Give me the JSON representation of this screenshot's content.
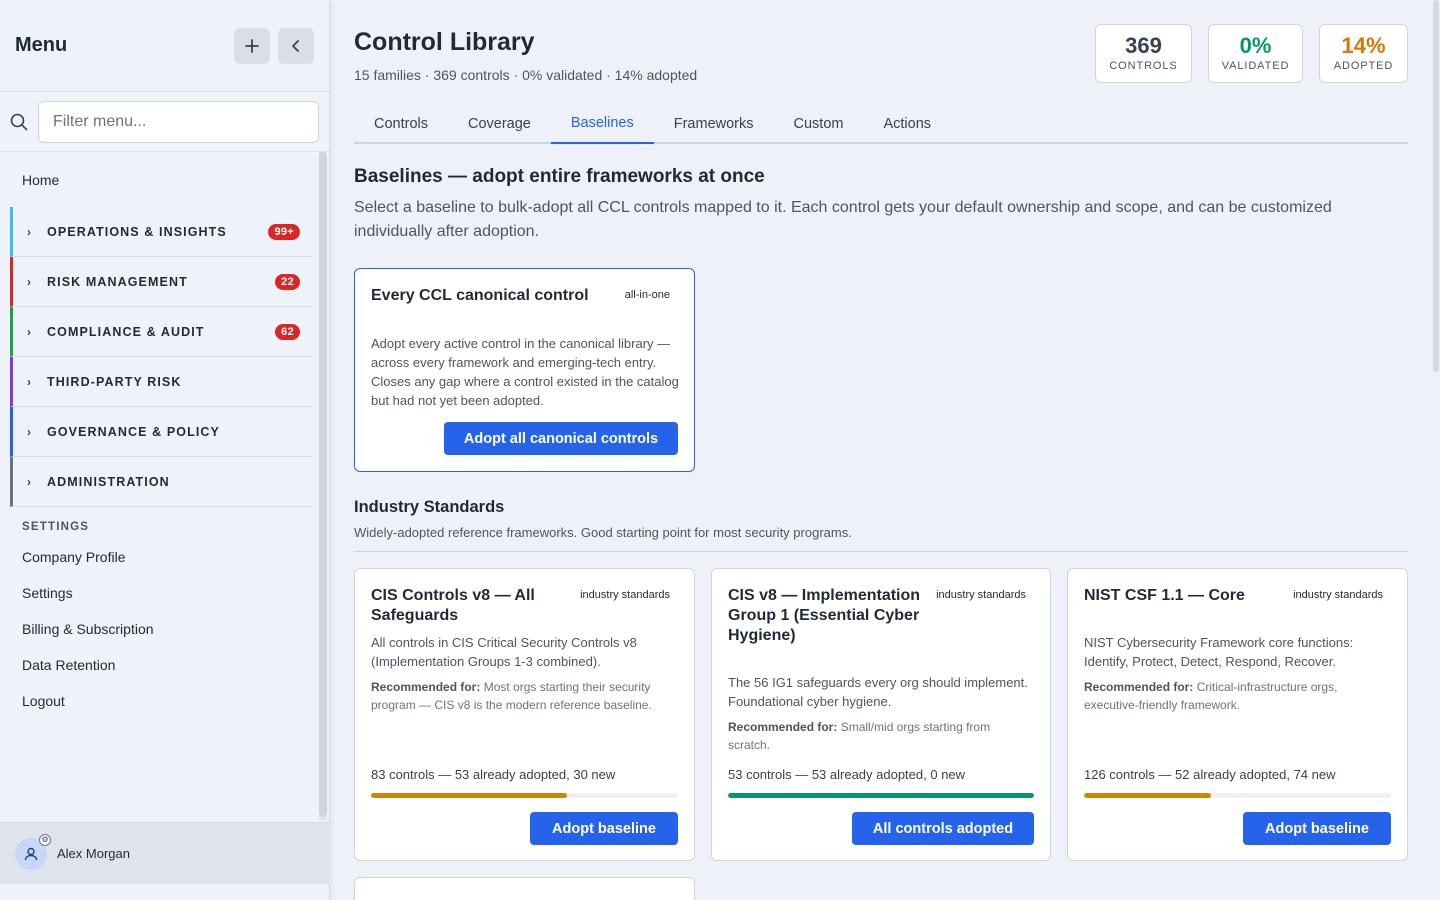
{
  "sidebar": {
    "title": "Menu",
    "search_placeholder": "Filter menu...",
    "home_label": "Home",
    "groups": [
      {
        "label": "OPERATIONS & INSIGHTS",
        "badge": "99+",
        "color": "#38bdf8"
      },
      {
        "label": "RISK MANAGEMENT",
        "badge": "22",
        "color": "#dc2626"
      },
      {
        "label": "COMPLIANCE & AUDIT",
        "badge": "62",
        "color": "#16a34a"
      },
      {
        "label": "THIRD-PARTY RISK",
        "badge": "",
        "color": "#7c3aed"
      },
      {
        "label": "GOVERNANCE & POLICY",
        "badge": "",
        "color": "#2563eb"
      },
      {
        "label": "ADMINISTRATION",
        "badge": "",
        "color": "#6b7280"
      }
    ],
    "settings_header": "SETTINGS",
    "settings_items": [
      "Company Profile",
      "Settings",
      "Billing & Subscription",
      "Data Retention",
      "Logout"
    ],
    "user_name": "Alex Morgan"
  },
  "header": {
    "title": "Control Library",
    "subtitle": "15 families · 369 controls · 0% validated · 14% adopted",
    "stats": [
      {
        "value": "369",
        "label": "CONTROLS",
        "color": "#374151"
      },
      {
        "value": "0%",
        "label": "VALIDATED",
        "color": "#059669"
      },
      {
        "value": "14%",
        "label": "ADOPTED",
        "color": "#d97706"
      }
    ]
  },
  "tabs": [
    "Controls",
    "Coverage",
    "Baselines",
    "Frameworks",
    "Custom",
    "Actions"
  ],
  "active_tab": "Baselines",
  "baselines": {
    "title": "Baselines — adopt entire frameworks at once",
    "description": "Select a baseline to bulk-adopt all CCL controls mapped to it. Each control gets your default ownership and scope, and can be customized individually after adoption.",
    "canonical": {
      "title": "Every CCL canonical control",
      "tag": "all-in-one",
      "description": "Adopt every active control in the canonical library — across every framework and emerging-tech entry. Closes any gap where a control existed in the catalog but had not yet been adopted.",
      "button": "Adopt all canonical controls"
    }
  },
  "industry": {
    "title": "Industry Standards",
    "description": "Widely-adopted reference frameworks. Good starting point for most security programs.",
    "cards": [
      {
        "title": "CIS Controls v8 — All Safeguards",
        "tag": "industry standards",
        "description": "All controls in CIS Critical Security Controls v8 (Implementation Groups 1-3 combined).",
        "rec_label": "Recommended for:",
        "rec_text": "Most orgs starting their security program — CIS v8 is the modern reference baseline.",
        "count_text": "83 controls — 53 already adopted, 30 new",
        "progress": 0.639,
        "bar_color": "#ca8a04",
        "button": "Adopt baseline"
      },
      {
        "title": "CIS v8 — Implementation Group 1 (Essential Cyber Hygiene)",
        "tag": "industry standards",
        "description": "The 56 IG1 safeguards every org should implement. Foundational cyber hygiene.",
        "rec_label": "Recommended for:",
        "rec_text": "Small/mid orgs starting from scratch.",
        "count_text": "53 controls — 53 already adopted, 0 new",
        "progress": 1.0,
        "bar_color": "#059669",
        "button": "All controls adopted"
      },
      {
        "title": "NIST CSF 1.1 — Core",
        "tag": "industry standards",
        "description": "NIST Cybersecurity Framework core functions: Identify, Protect, Detect, Respond, Recover.",
        "rec_label": "Recommended for:",
        "rec_text": "Critical-infrastructure orgs, executive-friendly framework.",
        "count_text": "126 controls — 52 already adopted, 74 new",
        "progress": 0.413,
        "bar_color": "#ca8a04",
        "button": "Adopt baseline"
      }
    ]
  }
}
